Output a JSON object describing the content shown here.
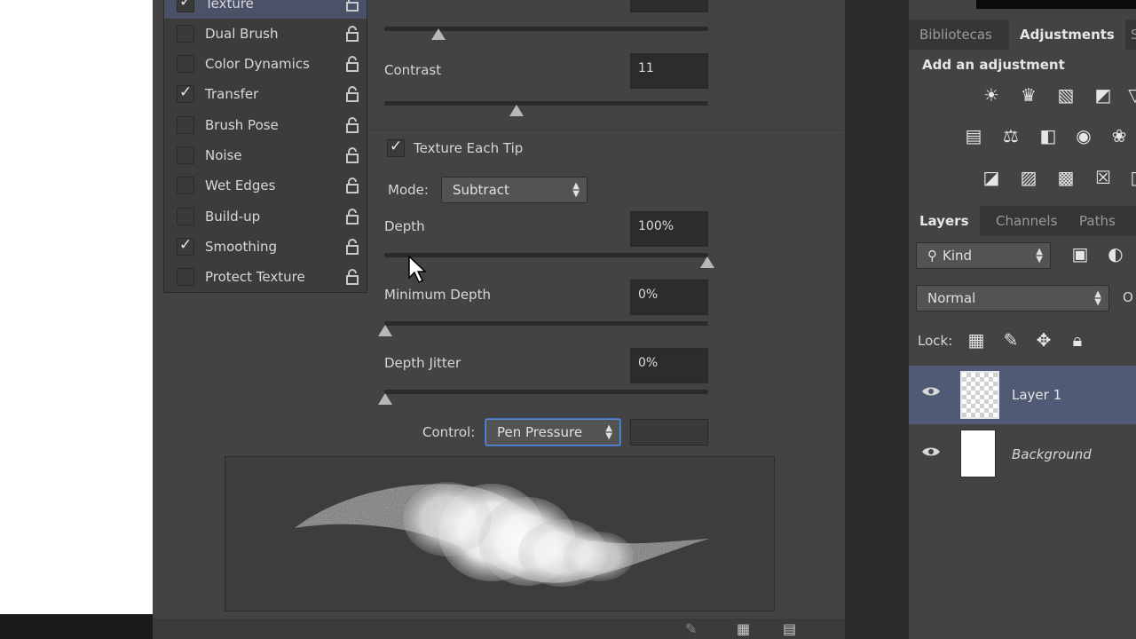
{
  "brush_settings": {
    "items": [
      {
        "label": "Texture",
        "checked": true,
        "selected": true
      },
      {
        "label": "Dual Brush",
        "checked": false
      },
      {
        "label": "Color Dynamics",
        "checked": false
      },
      {
        "label": "Transfer",
        "checked": true
      },
      {
        "label": "Brush Pose",
        "checked": false
      },
      {
        "label": "Noise",
        "checked": false
      },
      {
        "label": "Wet Edges",
        "checked": false
      },
      {
        "label": "Build-up",
        "checked": false
      },
      {
        "label": "Smoothing",
        "checked": true
      },
      {
        "label": "Protect Texture",
        "checked": false
      }
    ]
  },
  "texture": {
    "contrast_label": "Contrast",
    "contrast_value": "11",
    "texture_each_tip_label": "Texture Each Tip",
    "mode_label": "Mode:",
    "mode_value": "Subtract",
    "depth_label": "Depth",
    "depth_value": "100%",
    "min_depth_label": "Minimum Depth",
    "min_depth_value": "0%",
    "depth_jitter_label": "Depth Jitter",
    "depth_jitter_value": "0%",
    "control_label": "Control:",
    "control_value": "Pen Pressure"
  },
  "adjustments_panel": {
    "tabs": [
      "Bibliotecas",
      "Adjustments",
      "S"
    ],
    "heading": "Add an adjustment"
  },
  "layers_panel": {
    "tabs": [
      "Layers",
      "Channels",
      "Paths"
    ],
    "filter_kind": "Kind",
    "blend_mode": "Normal",
    "opacity_label_cut": "O",
    "lock_label": "Lock:",
    "layers": [
      {
        "name": "Layer 1",
        "selected": true
      },
      {
        "name": "Background",
        "selected": false
      }
    ]
  }
}
